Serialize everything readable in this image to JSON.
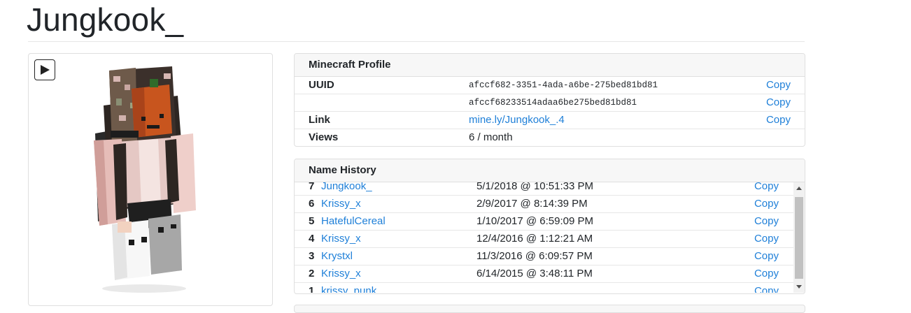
{
  "page": {
    "title": "Jungkook_"
  },
  "skin_viewer": {
    "play_icon": "play-icon"
  },
  "profile": {
    "header": "Minecraft Profile",
    "copy_label": "Copy",
    "rows": {
      "uuid": {
        "label": "UUID",
        "value": "afccf682-3351-4ada-a6be-275bed81bd81"
      },
      "uuid_short": {
        "label": "",
        "value": "afccf68233514adaa6be275bed81bd81"
      },
      "link": {
        "label": "Link",
        "value": "mine.ly/Jungkook_.4"
      },
      "views": {
        "label": "Views",
        "value": "6 / month"
      }
    }
  },
  "name_history": {
    "header": "Name History",
    "copy_label": "Copy",
    "entries": [
      {
        "num": "7",
        "name": "Jungkook_",
        "date": "5/1/2018 @ 10:51:33 PM"
      },
      {
        "num": "6",
        "name": "Krissy_x",
        "date": "2/9/2017 @ 8:14:39 PM"
      },
      {
        "num": "5",
        "name": "HatefulCereal",
        "date": "1/10/2017 @ 6:59:09 PM"
      },
      {
        "num": "4",
        "name": "Krissy_x",
        "date": "12/4/2016 @ 1:12:21 AM"
      },
      {
        "num": "3",
        "name": "Krystxl",
        "date": "11/3/2016 @ 6:09:57 PM"
      },
      {
        "num": "2",
        "name": "Krissy_x",
        "date": "6/14/2015 @ 3:48:11 PM"
      },
      {
        "num": "1",
        "name": "krissy_punk",
        "date": ""
      }
    ]
  },
  "colors": {
    "link": "#1e7fd8",
    "border": "#dfdfdf",
    "header_bg": "#f7f7f7"
  }
}
